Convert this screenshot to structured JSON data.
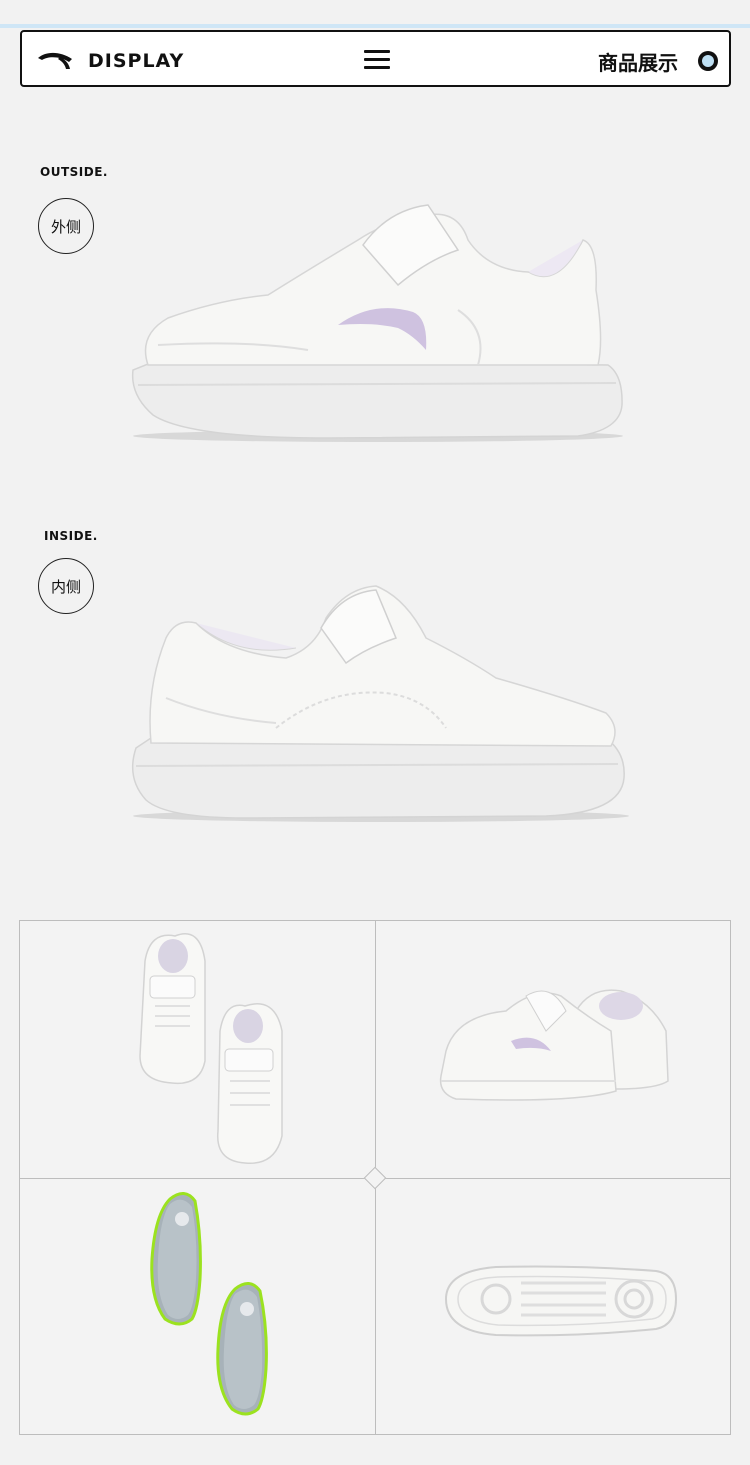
{
  "header": {
    "brand": "DISPLAY",
    "title": "商品展示"
  },
  "sections": [
    {
      "label": "OUTSIDE.",
      "badge": "外侧"
    },
    {
      "label": "INSIDE.",
      "badge": "内侧"
    }
  ],
  "colors": {
    "accent_line": "#cfe6f6",
    "logo_accent": "#c9b8e0",
    "insole_green": "#9be21f"
  },
  "icons": [
    "anta-logo-icon",
    "hamburger-menu-icon",
    "circle-dot-icon"
  ]
}
